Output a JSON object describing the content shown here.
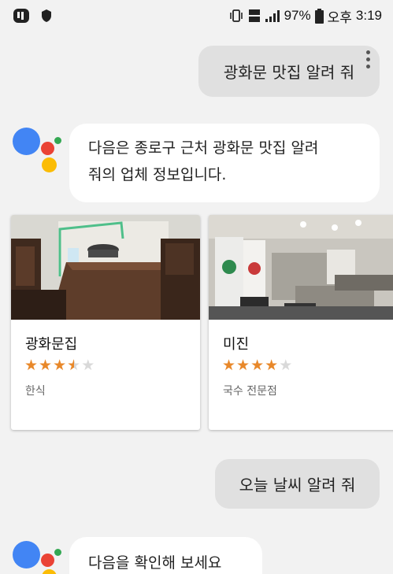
{
  "status_bar": {
    "battery_percent": "97%",
    "ampm": "오후",
    "time": "3:19",
    "network": "LTE"
  },
  "conversation": {
    "user_query_1": "광화문 맛집 알려 줘",
    "assistant_reply_1_line1": "다음은 종로구 근처 광화문 맛집 알려",
    "assistant_reply_1_line2": "줘의 업체 정보입니다.",
    "user_query_2": "오늘 날씨 알려 줘",
    "assistant_reply_2": "다음을 확인해 보세요"
  },
  "restaurants": [
    {
      "name": "광화문집",
      "rating": 3.5,
      "category": "한식"
    },
    {
      "name": "미진",
      "rating": 4,
      "category": "국수 전문점"
    }
  ],
  "colors": {
    "star": "#e8882a",
    "star_empty": "#d9d9d9",
    "assistant_blue": "#4285f4",
    "assistant_red": "#ea4335",
    "assistant_yellow": "#fbbc05",
    "assistant_green": "#34a853"
  }
}
